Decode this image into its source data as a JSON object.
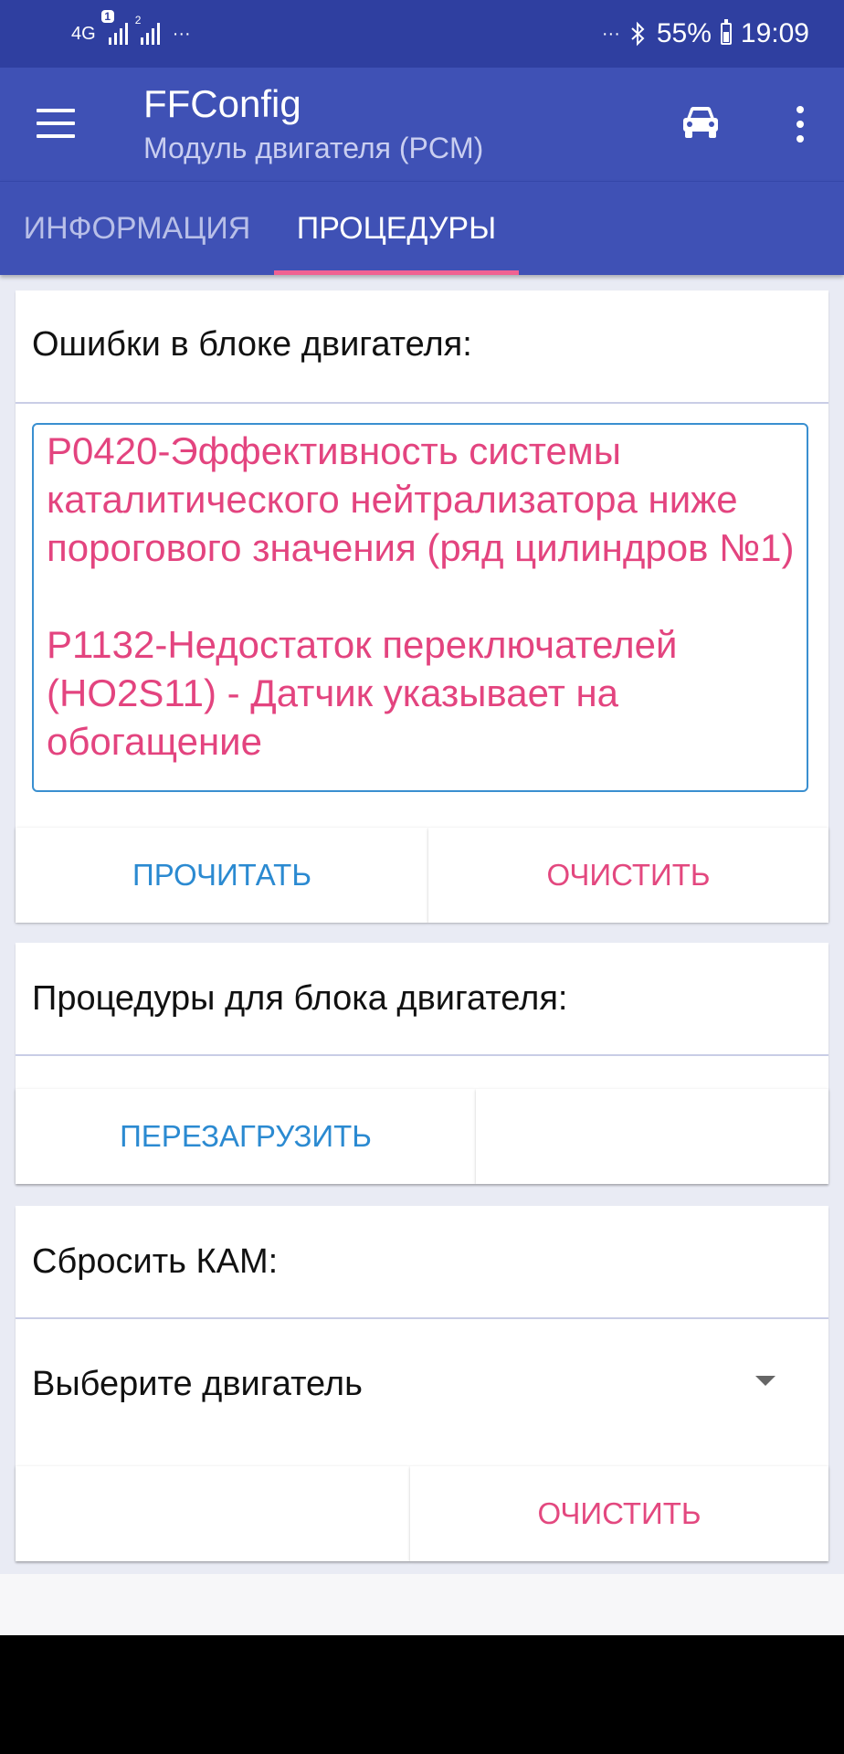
{
  "status_bar": {
    "network": "4G",
    "sim1_badge": "1",
    "sim2_badge": "2",
    "left_more": "···",
    "right_more": "···",
    "battery": "55%",
    "time": "19:09"
  },
  "app_bar": {
    "title": "FFConfig",
    "subtitle": "Модуль двигателя (PCM)"
  },
  "tabs": [
    {
      "label": "ИНФОРМАЦИЯ",
      "selected": false
    },
    {
      "label": "ПРОЦЕДУРЫ",
      "selected": true
    }
  ],
  "errors_card": {
    "title": "Ошибки в блоке двигателя:",
    "errors": [
      "P0420-Эффективность системы каталитического нейтрализатора ниже порогового значения (ряд цилиндров №1)",
      "P1132-Недостаток переключателей (HO2S11) - Датчик указывает на обогащение"
    ],
    "read_button": "ПРОЧИТАТЬ",
    "clear_button": "ОЧИСТИТЬ"
  },
  "procedures_card": {
    "title": "Процедуры для блока двигателя:",
    "restart_button": "ПЕРЕЗАГРУЗИТЬ"
  },
  "kam_card": {
    "title": "Сбросить КАМ:",
    "engine_select": "Выберите двигатель",
    "clear_button": "ОЧИСТИТЬ"
  },
  "colors": {
    "status_bar": "#2f3fa0",
    "primary": "#3f51b5",
    "accent": "#f06292",
    "error_text": "#e3447f",
    "button_blue": "#2b8ad1",
    "button_pink": "#e3487f"
  }
}
